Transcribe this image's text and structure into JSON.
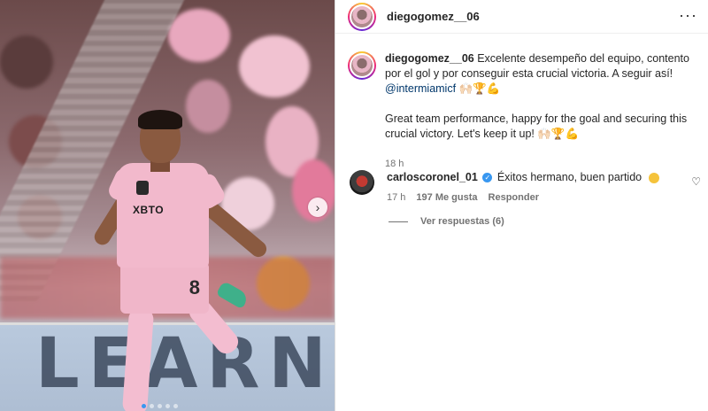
{
  "post": {
    "username": "diegogomez__06",
    "more_icon": "more-horizontal-icon",
    "caption": {
      "username": "diegogomez__06",
      "text_es": " Excelente desempeño del equipo, contento por el gol y por conseguir esta crucial victoria. A seguir así!",
      "mention": "@intermiamicf",
      "emojis_1": " 🙌🏻🏆💪",
      "text_en": "Great team performance, happy for the goal and securing this crucial victory. Let's keep it up!",
      "emojis_2": " 🙌🏻🏆💪",
      "time": "18 h"
    },
    "photo": {
      "jersey_sponsor": "XBTO",
      "shorts_number": "8",
      "board_text": "LEARN M",
      "next_icon": "chevron-right-icon"
    }
  },
  "comments": [
    {
      "username": "carloscoronel_01",
      "verified": true,
      "text": "Éxitos hermano, buen partido",
      "emoji": "clapping-hands-icon",
      "time": "17 h",
      "likes": "197 Me gusta",
      "reply_label": "Responder",
      "view_replies": "Ver respuestas (6)"
    }
  ],
  "colors": {
    "verified": "#3897f0",
    "mention": "#00376b",
    "jersey_pink": "#f2b9cc",
    "muted_text": "#737373"
  }
}
